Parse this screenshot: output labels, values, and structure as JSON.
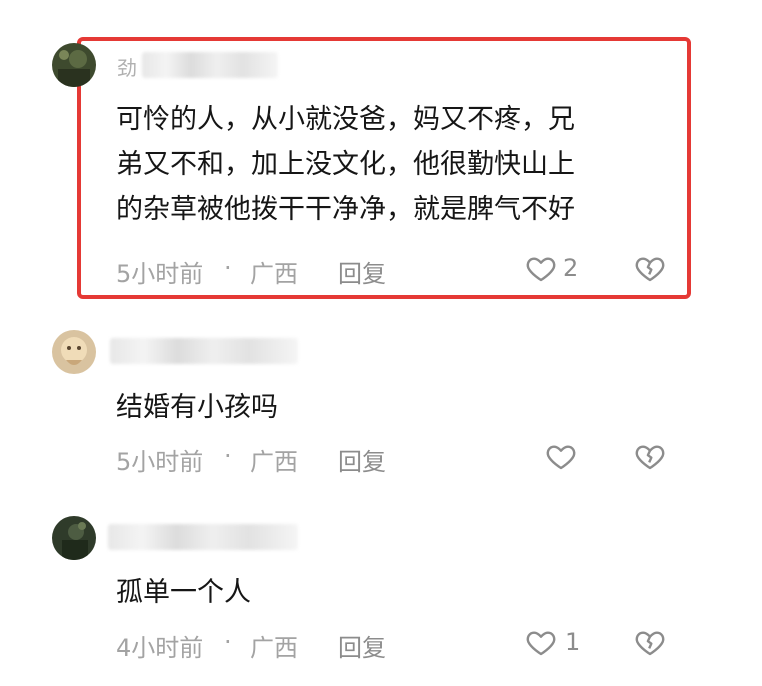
{
  "colors": {
    "highlight_border": "#e53935",
    "text_primary": "#161616",
    "text_meta": "#a3a3a3"
  },
  "comments": [
    {
      "username": "劲",
      "lines": [
        "可怜的人，从小就没爸，妈又不疼，兄",
        "弟又不和，加上没文化，他很勤快山上",
        "的杂草被他拨干干净净，就是脾气不好"
      ],
      "time": "5小时前",
      "dot": "·",
      "location": "广西",
      "reply_label": "回复",
      "likes": "2",
      "like_icon": "heart-outline-icon",
      "dislike_icon": "broken-heart-icon",
      "highlighted": true
    },
    {
      "username": "",
      "lines": [
        "结婚有小孩吗"
      ],
      "time": "5小时前",
      "dot": "·",
      "location": "广西",
      "reply_label": "回复",
      "likes": "",
      "like_icon": "heart-outline-icon",
      "dislike_icon": "broken-heart-icon",
      "highlighted": false
    },
    {
      "username": "",
      "lines": [
        "孤单一个人"
      ],
      "time": "4小时前",
      "dot": "·",
      "location": "广西",
      "reply_label": "回复",
      "likes": "1",
      "like_icon": "heart-outline-icon",
      "dislike_icon": "broken-heart-icon",
      "highlighted": false
    }
  ]
}
